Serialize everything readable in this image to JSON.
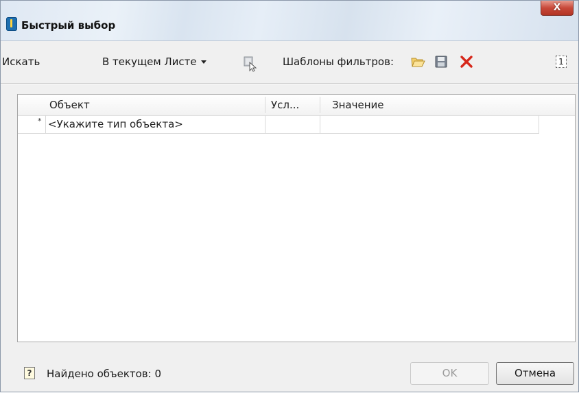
{
  "window": {
    "title": "Быстрый выбор",
    "close_label": "X"
  },
  "toolbar": {
    "search_label": "Искать",
    "scope_label": "В текущем Листе",
    "filter_templates_label": "Шаблоны фильтров:",
    "paging_label": "1"
  },
  "grid": {
    "columns": [
      "Объект",
      "Усл...",
      "Значение"
    ],
    "rows": [
      {
        "marker": "*",
        "object": "<Укажите тип объекта>",
        "condition": "",
        "value": ""
      }
    ]
  },
  "status": {
    "help_label": "?",
    "found_text": "Найдено объектов: 0"
  },
  "buttons": {
    "ok_label": "OK",
    "cancel_label": "Отмена"
  }
}
